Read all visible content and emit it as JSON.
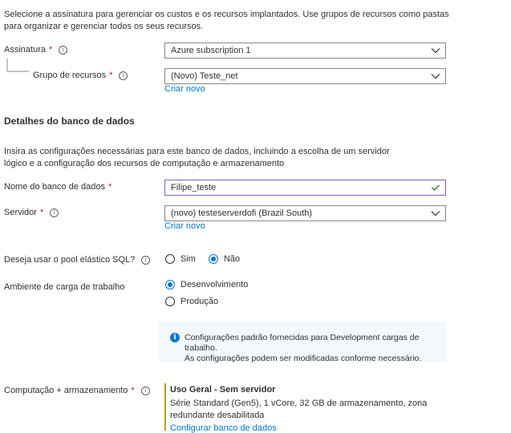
{
  "intro": "Selecione a assinatura para gerenciar os custos e os recursos implantados. Use grupos de recursos como pastas para organizar e gerenciar todos os seus recursos.",
  "subscription": {
    "label": "Assinatura",
    "required": "*",
    "value": "Azure subscription 1"
  },
  "resource_group": {
    "label": "Grupo de recursos",
    "required": "*",
    "value": "(Novo) Teste_net",
    "create_link": "Criar novo"
  },
  "db_section": {
    "title": "Detalhes do banco de dados",
    "description": "Insira as configurações necessárias para este banco de dados, incluindo a escolha de um servidor lógico e a configuração dos recursos de computação e armazenamento"
  },
  "db_name": {
    "label": "Nome do banco de dados",
    "required": "*",
    "value": "Filipe_teste"
  },
  "server": {
    "label": "Servidor",
    "required": "*",
    "value": "(novo) testeserverdofi (Brazil South)",
    "create_link": "Criar novo"
  },
  "elastic_pool": {
    "label": "Deseja usar o pool elástico SQL?",
    "options": [
      "Sim",
      "Não"
    ],
    "selected": "Não"
  },
  "workload": {
    "label": "Ambiente de carga de trabalho",
    "options": [
      "Desenvolvimento",
      "Produção"
    ],
    "selected": "Desenvolvimento",
    "info_line1": "Configurações padrão fornecidas para Development cargas de trabalho.",
    "info_line2": "As configurações podem ser modificadas conforme necessário."
  },
  "compute": {
    "label": "Computação + armazenamento",
    "required": "*",
    "tier": "Uso Geral - Sem servidor",
    "details": "Série Standard (Gen5), 1 vCore, 32 GB de armazenamento, zona redundante desabilitada",
    "configure_link": "Configurar banco de dados"
  },
  "colors": {
    "accent": "#0078d4",
    "required": "#a4262c",
    "valid": "#107c10",
    "focus_border": "#8661c5",
    "compute_bar": "#c19c00"
  },
  "icons": {
    "info": "info-icon",
    "chevron": "chevron-down-icon",
    "check": "check-icon"
  }
}
